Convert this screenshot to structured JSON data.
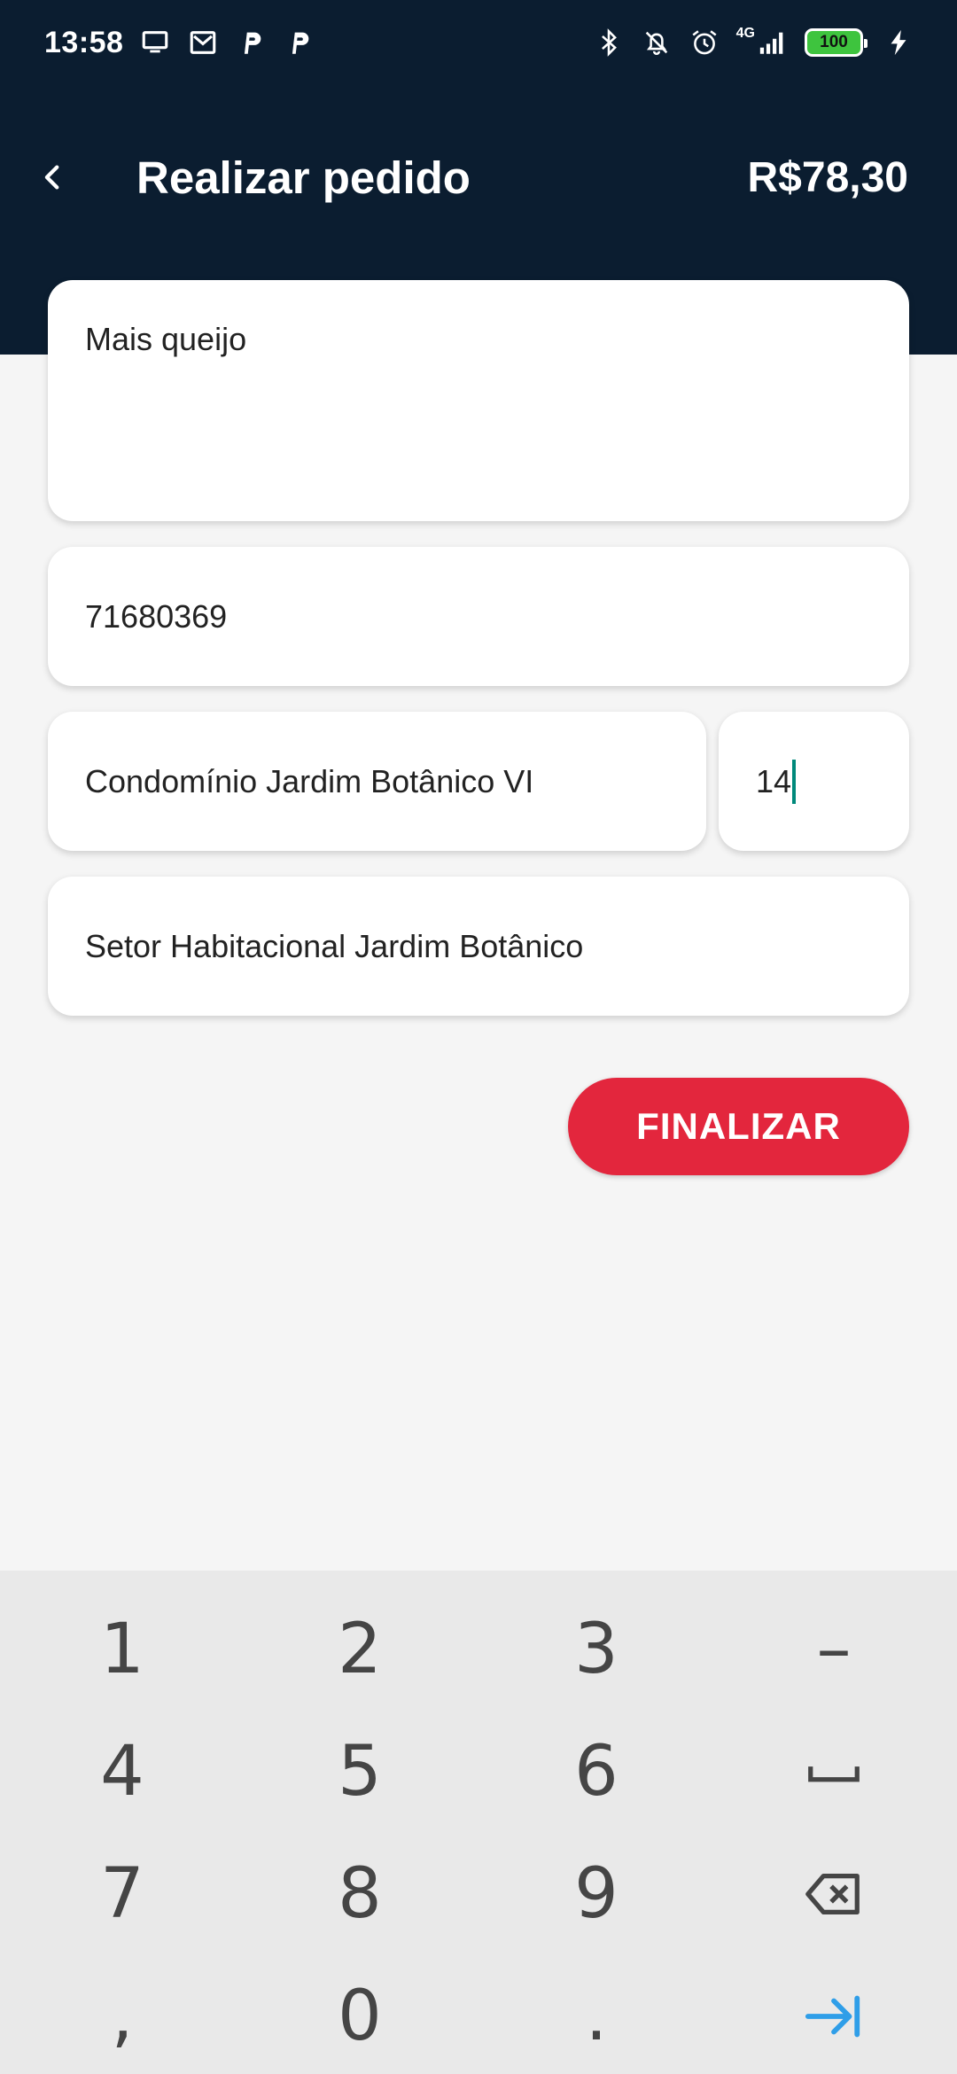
{
  "status_bar": {
    "time": "13:58",
    "network_label": "4G",
    "battery": "100",
    "left_icons": [
      "monitor-icon",
      "mail-icon",
      "parking-p-icon",
      "parking-p-icon"
    ],
    "right_icons": [
      "bluetooth-icon",
      "mute-icon",
      "alarm-icon",
      "signal-icon",
      "battery-icon",
      "charging-icon"
    ]
  },
  "header": {
    "title": "Realizar pedido",
    "total": "R$78,30",
    "back_icon": "chevron-left-icon"
  },
  "form": {
    "notes_value": "Mais queijo",
    "cep_value": "71680369",
    "address_value": "Condomínio Jardim Botânico VI",
    "number_value": "14",
    "neighborhood_value": "Setor Habitacional Jardim Botânico"
  },
  "actions": {
    "finish_label": "FINALIZAR"
  },
  "keyboard": {
    "rows": [
      [
        "1",
        "2",
        "3",
        "–"
      ],
      [
        "4",
        "5",
        "6",
        "space-icon"
      ],
      [
        "7",
        "8",
        "9",
        "backspace-icon"
      ],
      [
        ",",
        "0",
        ".",
        "tab-next-icon"
      ]
    ]
  },
  "colors": {
    "header": "#0b1d30",
    "accent": "#e3263d",
    "caret": "#00897b",
    "keyboard_bg": "#e9e9e9",
    "key_action_blue": "#2f9ee8"
  }
}
